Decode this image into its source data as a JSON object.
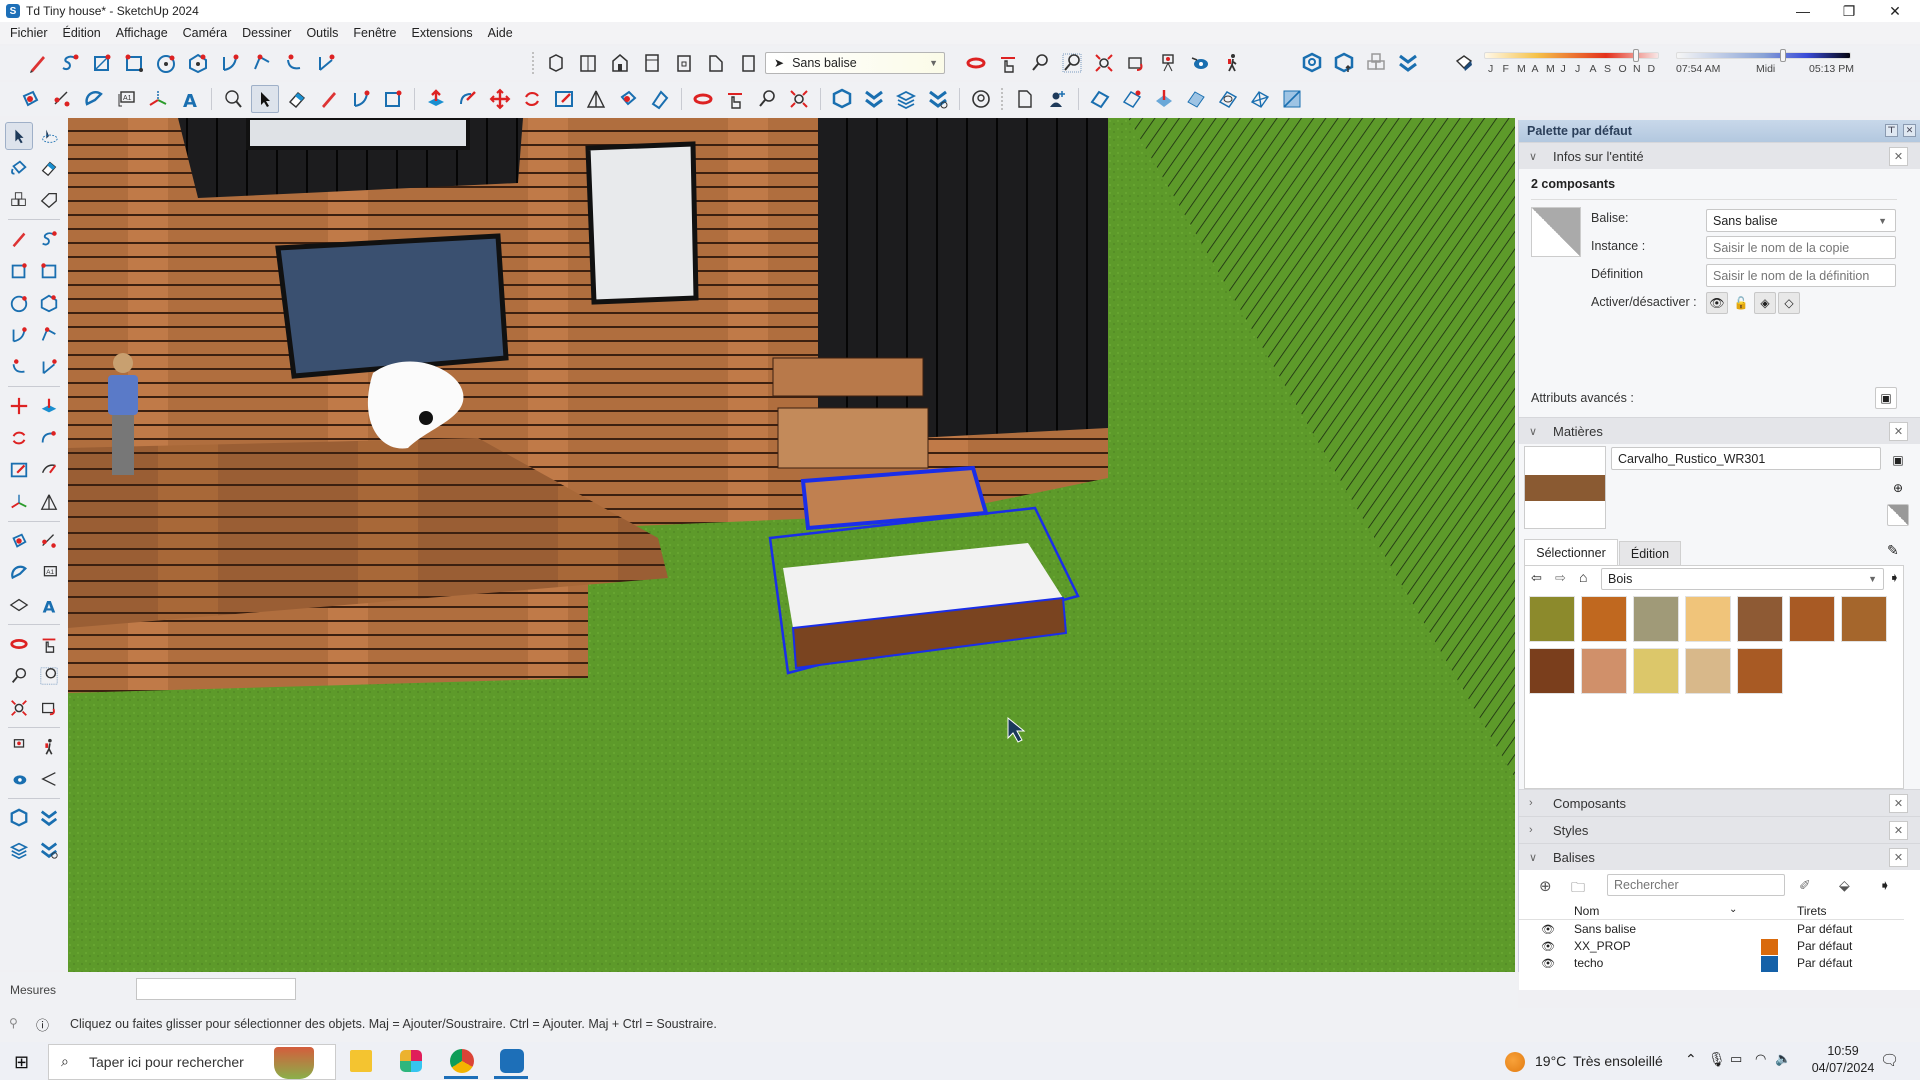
{
  "window": {
    "title": "Td Tiny house* - SketchUp 2024",
    "controls": {
      "minimize": "—",
      "restore": "❐",
      "close": "✕"
    }
  },
  "menu": [
    "Fichier",
    "Édition",
    "Affichage",
    "Caméra",
    "Dessiner",
    "Outils",
    "Fenêtre",
    "Extensions",
    "Aide"
  ],
  "toolbar": {
    "tag_dropdown_value": "Sans balise",
    "shadows": {
      "months": [
        "J",
        "F",
        "M",
        "A",
        "M",
        "J",
        "J",
        "A",
        "S",
        "O",
        "N",
        "D"
      ],
      "month_position": 0.86,
      "time_start": "07:54 AM",
      "time_mid": "Midi",
      "time_end": "05:13 PM",
      "time_position": 0.6
    }
  },
  "tray": {
    "title": "Palette par défaut",
    "entity_info": {
      "header": "Infos sur l'entité",
      "selection": "2 composants",
      "tag_label": "Balise:",
      "tag_value": "Sans balise",
      "instance_label": "Instance :",
      "instance_placeholder": "Saisir le nom de la copie",
      "definition_label": "Définition",
      "definition_placeholder": "Saisir le nom de la définition",
      "toggle_label": "Activer/désactiver :",
      "advanced_label": "Attributs avancés :"
    },
    "materials": {
      "header": "Matières",
      "current_name": "Carvalho_Rustico_WR301",
      "current_color": "#8a5a32",
      "tabs": [
        "Sélectionner",
        "Édition"
      ],
      "library": "Bois",
      "swatches": [
        "#8c8a2c",
        "#c0681f",
        "#a09a78",
        "#f0c47a",
        "#8e5a34",
        "#a85a24",
        "#a5662c",
        "#7a3e1c",
        "#d0906a",
        "#dcc76a",
        "#d8b88a",
        "#a85a24"
      ]
    },
    "sections_collapsed": [
      "Composants",
      "Styles"
    ],
    "tags": {
      "header": "Balises",
      "search_placeholder": "Rechercher",
      "col_name": "Nom",
      "col_dash": "Tirets",
      "rows": [
        {
          "name": "Sans balise",
          "dash": "Par défaut",
          "color": ""
        },
        {
          "name": "XX_PROP",
          "dash": "Par défaut",
          "color": "#d96a0c"
        },
        {
          "name": "techo",
          "dash": "Par défaut",
          "color": "#1561a8"
        }
      ]
    }
  },
  "measurements": {
    "label": "Mesures",
    "value": ""
  },
  "status": {
    "hint": "Cliquez ou faites glisser pour sélectionner des objets. Maj = Ajouter/Soustraire. Ctrl = Ajouter. Maj + Ctrl = Soustraire."
  },
  "taskbar": {
    "search_placeholder": "Taper ici pour rechercher",
    "weather_temp": "19°C",
    "weather_text": "Très ensoleillé",
    "time": "10:59",
    "date": "04/07/2024"
  }
}
